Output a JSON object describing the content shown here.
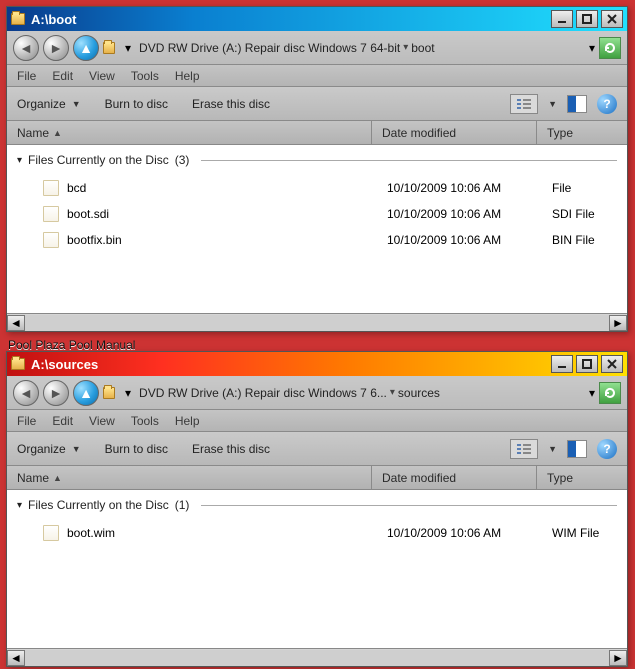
{
  "windows": [
    {
      "title": "A:\\boot",
      "breadcrumbs": {
        "drive": "DVD RW Drive (A:) Repair disc Windows 7 64-bit",
        "folder": "boot"
      },
      "menu": {
        "file": "File",
        "edit": "Edit",
        "view": "View",
        "tools": "Tools",
        "help": "Help"
      },
      "toolbar": {
        "organize": "Organize",
        "burn": "Burn to disc",
        "erase": "Erase this disc"
      },
      "columns": {
        "name": "Name",
        "date": "Date modified",
        "type": "Type"
      },
      "group": {
        "label": "Files Currently on the Disc",
        "count": "(3)"
      },
      "files": [
        {
          "name": "bcd",
          "date": "10/10/2009 10:06 AM",
          "type": "File"
        },
        {
          "name": "boot.sdi",
          "date": "10/10/2009 10:06 AM",
          "type": "SDI File"
        },
        {
          "name": "bootfix.bin",
          "date": "10/10/2009 10:06 AM",
          "type": "BIN File"
        }
      ]
    },
    {
      "title": "A:\\sources",
      "breadcrumbs": {
        "drive": "DVD RW Drive (A:) Repair disc Windows 7 6...",
        "folder": "sources"
      },
      "menu": {
        "file": "File",
        "edit": "Edit",
        "view": "View",
        "tools": "Tools",
        "help": "Help"
      },
      "toolbar": {
        "organize": "Organize",
        "burn": "Burn to disc",
        "erase": "Erase this disc"
      },
      "columns": {
        "name": "Name",
        "date": "Date modified",
        "type": "Type"
      },
      "group": {
        "label": "Files Currently on the Disc",
        "count": "(1)"
      },
      "files": [
        {
          "name": "boot.wim",
          "date": "10/10/2009 10:06 AM",
          "type": "WIM File"
        }
      ]
    }
  ],
  "taskbar_fragment": "Pool Plaza   Pool Manual"
}
